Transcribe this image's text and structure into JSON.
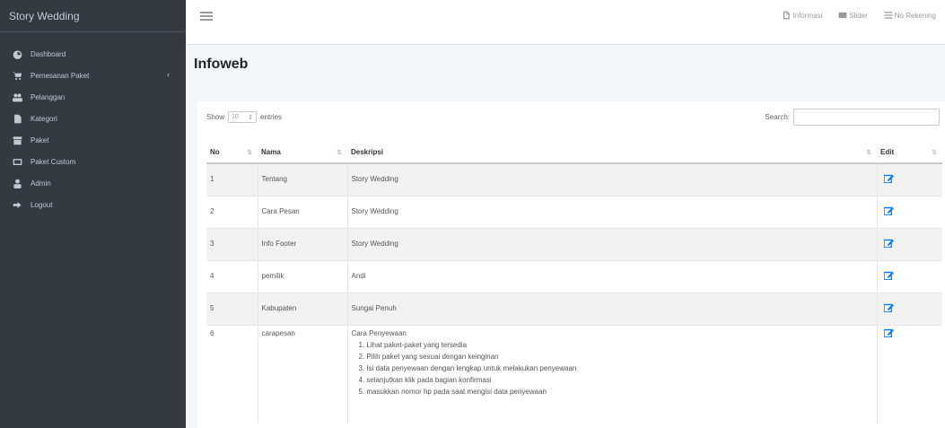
{
  "brand": "Story Wedding",
  "sidebar": {
    "items": [
      {
        "label": "Dashboard",
        "icon": "dashboard-icon"
      },
      {
        "label": "Pemesanan Paket",
        "icon": "cart-icon",
        "caret": "‹"
      },
      {
        "label": "Pelanggan",
        "icon": "users-icon"
      },
      {
        "label": "Kategori",
        "icon": "file-icon"
      },
      {
        "label": "Paket",
        "icon": "box-icon"
      },
      {
        "label": "Paket Custom",
        "icon": "card-icon"
      },
      {
        "label": "Admin",
        "icon": "user-icon"
      },
      {
        "label": "Logout",
        "icon": "logout-icon"
      }
    ]
  },
  "topbar": {
    "links": [
      {
        "label": "Informasi",
        "icon": "file-icon"
      },
      {
        "label": "Slider",
        "icon": "image-icon"
      },
      {
        "label": "No Rekening",
        "icon": "list-icon"
      }
    ]
  },
  "page": {
    "title": "Infoweb"
  },
  "table_controls": {
    "show_label": "Show",
    "entries_value": "10",
    "entries_label": "entries",
    "search_label": "Search:"
  },
  "table": {
    "headers": {
      "no": "No",
      "nama": "Nama",
      "deskripsi": "Deskripsi",
      "edit": "Edit"
    },
    "rows": [
      {
        "no": "1",
        "nama": "Tentang",
        "deskripsi": "Story Wedding"
      },
      {
        "no": "2",
        "nama": "Cara Pesan",
        "deskripsi": "Story Wedding"
      },
      {
        "no": "3",
        "nama": "Info Footer",
        "deskripsi": "Story Wedding"
      },
      {
        "no": "4",
        "nama": "pemilik",
        "deskripsi": "Andi"
      },
      {
        "no": "5",
        "nama": "Kabupaten",
        "deskripsi": "Sungai Penuh"
      },
      {
        "no": "6",
        "nama": "carapesan",
        "deskripsi": "Cara Penyewaan",
        "steps": [
          "1. Lihat paket-paket yang tersedia",
          "2. Pilih paket yang sesuai dengan keinginan",
          "3. Isi data penyewaan dengan lengkap untuk melakukan penyewaan",
          "4. selanjutkan klik pada bagian konfirmasi",
          "5. masukkan nomor hp pada saat mengisi data penyewaan"
        ]
      }
    ]
  },
  "colors": {
    "sidebar": "#343a40",
    "edit_icon": "#007bff"
  }
}
